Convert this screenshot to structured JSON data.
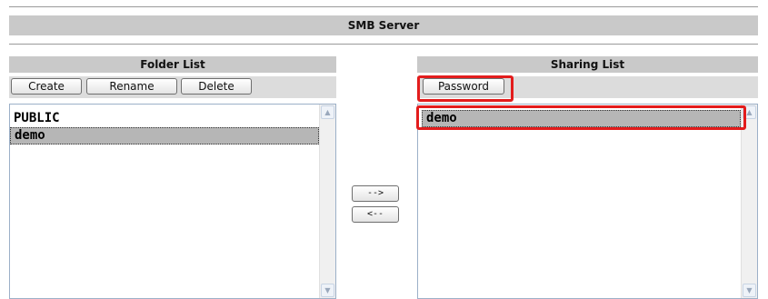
{
  "section": {
    "title": "SMB Server"
  },
  "folder_list": {
    "header": "Folder List",
    "buttons": {
      "create": "Create",
      "rename": "Rename",
      "delete": "Delete"
    },
    "items": [
      {
        "label": "PUBLIC",
        "selected": false
      },
      {
        "label": "demo",
        "selected": true
      }
    ]
  },
  "move_buttons": {
    "add": "-->",
    "remove": "<--"
  },
  "sharing_list": {
    "header": "Sharing List",
    "buttons": {
      "password": "Password"
    },
    "items": [
      {
        "label": "demo",
        "selected": true
      }
    ]
  },
  "icons": {
    "scroll_up": "scroll-up-arrow-icon",
    "scroll_down": "scroll-down-arrow-icon"
  },
  "colors": {
    "header_bg": "#c9c9c9",
    "selection_bg": "#b6b6b6",
    "highlight": "#e31c1c"
  }
}
